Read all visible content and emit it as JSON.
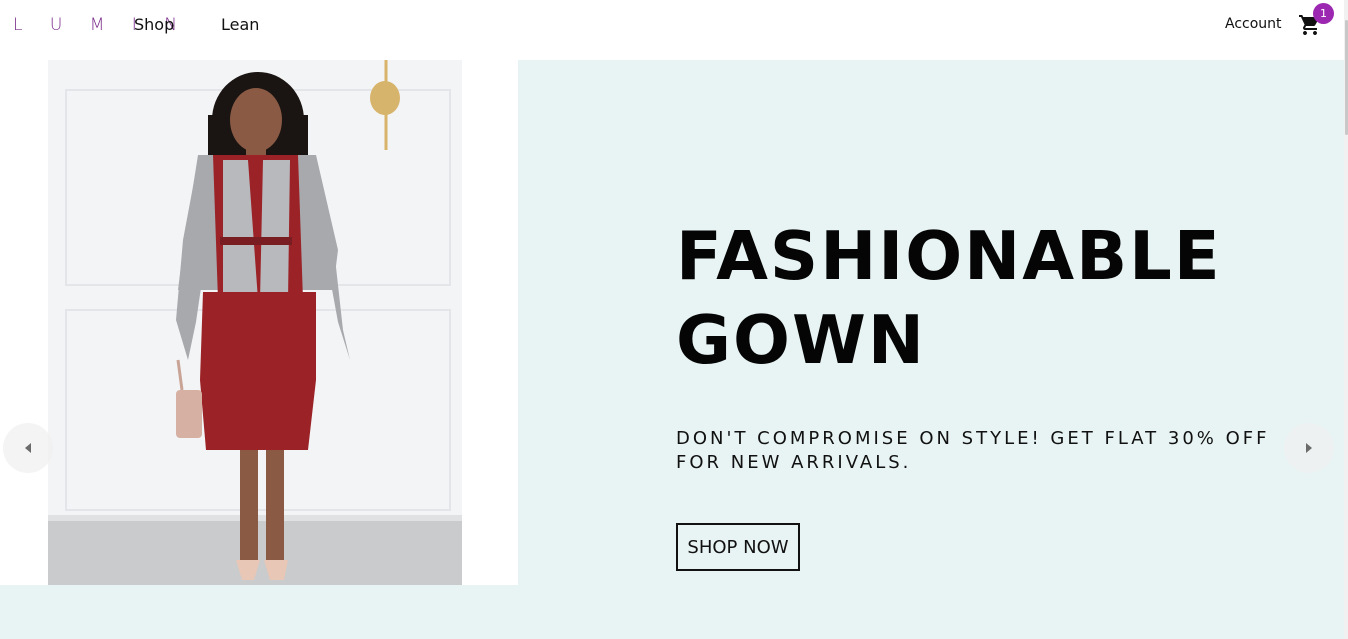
{
  "nav": {
    "brand": "L U M I N",
    "links": [
      "Shop",
      "Lean"
    ],
    "account": "Account",
    "cart_count": "1"
  },
  "hero": {
    "headline_line1": "FASHIONABLE",
    "headline_line2": "GOWN",
    "subtext_line1": "DON'T COMPROMISE ON STYLE! GET FLAT 30% OFF",
    "subtext_line2": "FOR NEW ARRIVALS.",
    "cta": "SHOP NOW"
  },
  "colors": {
    "brand": "#7b2d8b",
    "badge": "#9c27b0",
    "hero_bg": "#e8f3f3",
    "dress": "#9b2226"
  },
  "icons": {
    "cart": "shopping-cart-icon",
    "prev": "chevron-left-icon",
    "next": "chevron-right-icon"
  }
}
